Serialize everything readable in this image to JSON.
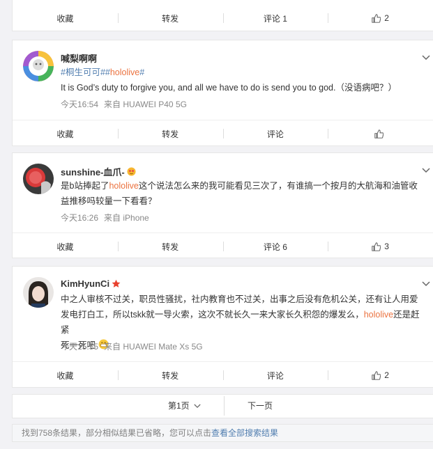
{
  "posts": [
    {
      "actions": {
        "collect": "收藏",
        "repost": "转发",
        "comment": "评论 1",
        "like": "2"
      }
    },
    {
      "username": "喊梨啊啊",
      "text_parts": {
        "tag1": "#桐生可可#",
        "tag2": "#",
        "tag_red": "hololive",
        "tag3": "#"
      },
      "body": "It is God’s duty to forgive you, and all we have to do is send you to god.（没语病吧？）",
      "time": "今天16:54",
      "source": "来自 HUAWEI P40 5G",
      "actions": {
        "collect": "收藏",
        "repost": "转发",
        "comment": "评论",
        "like": ""
      }
    },
    {
      "username": "sunshine-血爪-",
      "body_a": "是b站捧起了",
      "body_red": "hololive",
      "body_b": "这个说法怎么来的我可能看见三次了，有谁搞一个按月的大航海和油管收",
      "body_c": "益推移吗较量一下看看？",
      "time": "今天16:26",
      "source": "来自 iPhone",
      "actions": {
        "collect": "收藏",
        "repost": "转发",
        "comment": "评论 6",
        "like": "3"
      }
    },
    {
      "username": "KimHyunCi",
      "line1": "中之人审核不过关，职员性骚扰，社内教育也不过关，出事之后没有危机公关，还有让人用爱",
      "line2a": "发电打白工，所以tskk就一导火索，这次不就长久一来大家长久积怨的爆发么，",
      "line2red": "hololive",
      "line2b": "还是赶紧",
      "line3": "死一死吧",
      "time": "今天15:55",
      "source": "来自 HUAWEI Mate Xs 5G",
      "actions": {
        "collect": "收藏",
        "repost": "转发",
        "comment": "评论",
        "like": "2"
      }
    }
  ],
  "pager": {
    "page": "第1页",
    "next": "下一页"
  },
  "footer": {
    "text": "找到758条结果，部分相似结果已省略，您可以点击",
    "link": "查看全部搜索结果"
  },
  "colors": {
    "link": "#507daf",
    "highlight": "#eb7340",
    "muted": "#888888"
  }
}
